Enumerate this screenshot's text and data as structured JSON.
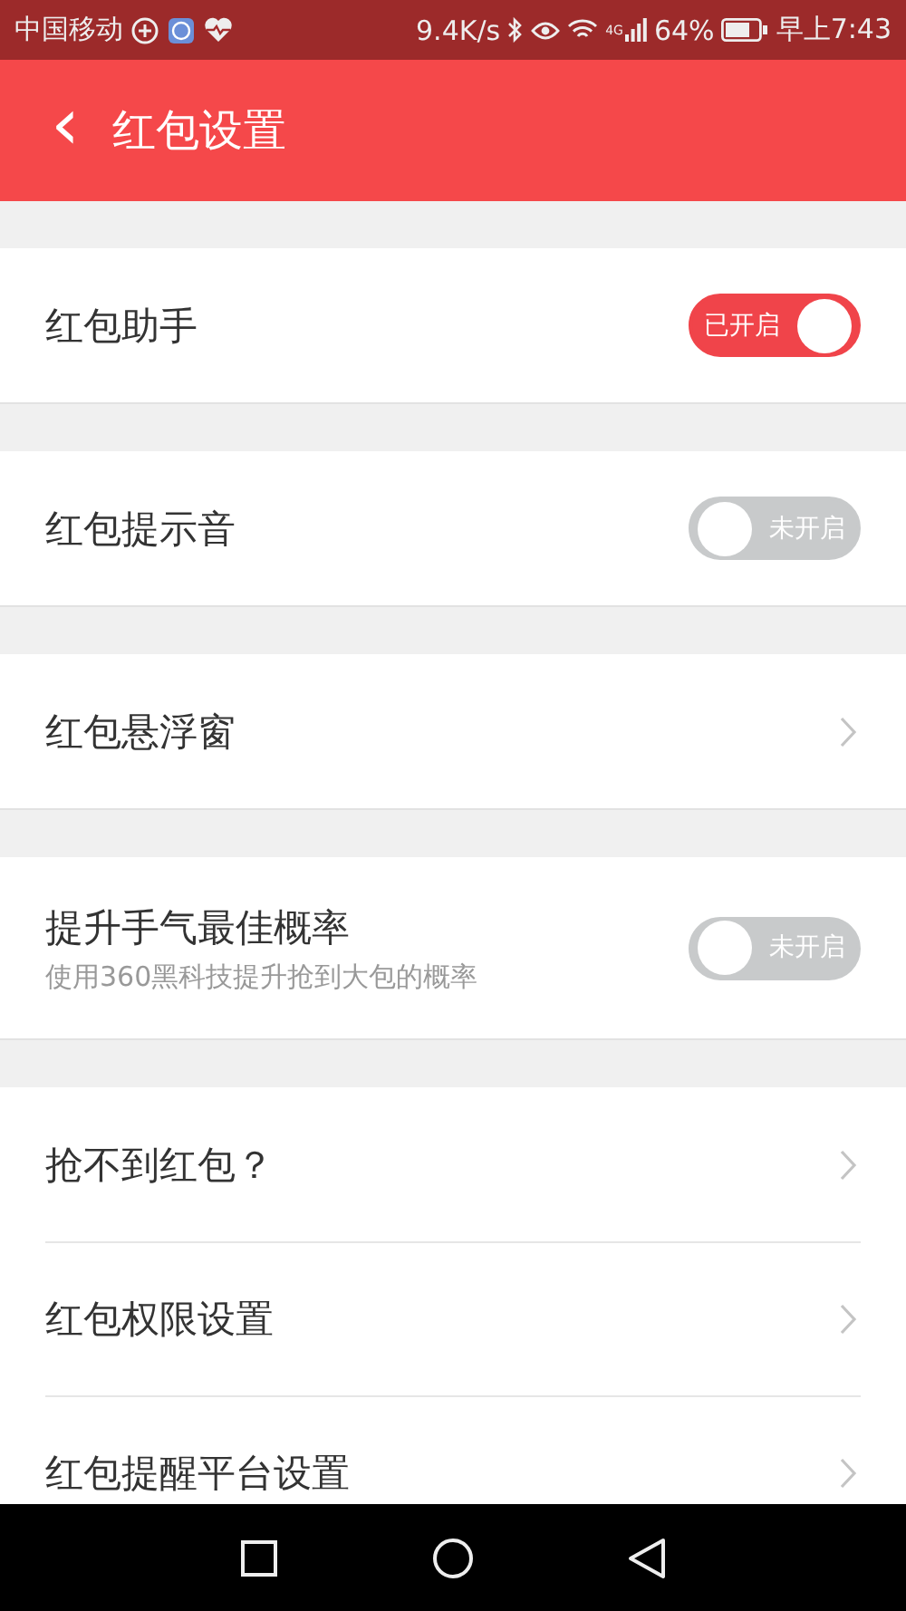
{
  "status_bar": {
    "carrier": "中国移动",
    "speed": "9.4K/s",
    "network": "4G",
    "battery": "64%",
    "time": "早上7:43"
  },
  "header": {
    "back": "‹",
    "title": "红包设置"
  },
  "sections": [
    {
      "items": [
        {
          "kind": "toggle",
          "label": "红包助手",
          "on": true,
          "state_text": "已开启"
        }
      ]
    },
    {
      "items": [
        {
          "kind": "toggle",
          "label": "红包提示音",
          "on": false,
          "state_text": "未开启"
        }
      ]
    },
    {
      "items": [
        {
          "kind": "link",
          "label": "红包悬浮窗"
        }
      ]
    },
    {
      "items": [
        {
          "kind": "toggle",
          "label": "提升手气最佳概率",
          "subtitle": "使用360黑科技提升抢到大包的概率",
          "on": false,
          "state_text": "未开启"
        }
      ]
    },
    {
      "items": [
        {
          "kind": "link",
          "label": "抢不到红包？"
        },
        {
          "kind": "link",
          "label": "红包权限设置"
        },
        {
          "kind": "link",
          "label": "红包提醒平台设置"
        }
      ]
    }
  ]
}
